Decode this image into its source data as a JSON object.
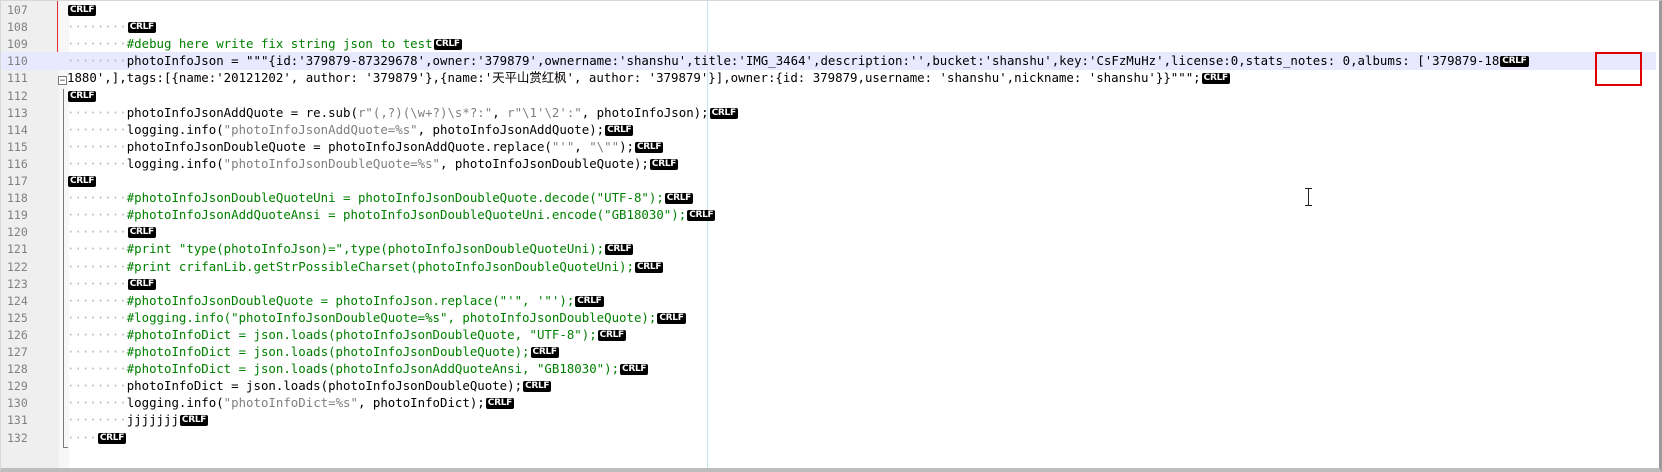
{
  "editor": {
    "eol_marker": "CRLF",
    "whitespace_marker": "·",
    "fold_box_symbol": "−",
    "colors": {
      "comment": "#008000",
      "string": "#808080",
      "current_line": "#e8e8ff",
      "highlight": "#e00000",
      "line_number": "#808080"
    },
    "lines": [
      {
        "number": "107",
        "indent": 0,
        "segments": [],
        "eol": true
      },
      {
        "number": "108",
        "indent": 8,
        "segments": [],
        "eol": true
      },
      {
        "number": "109",
        "indent": 8,
        "segments": [
          {
            "t": "#debug here write fix string json to test",
            "c": "cm"
          }
        ],
        "eol": true
      },
      {
        "number": "110",
        "indent": 8,
        "current": true,
        "segments": [
          {
            "t": "photoInfoJson = \"\"\"{id:'379879-87329678',owner:'379879',ownername:'shanshu',title:'IMG_3464',description:'',bucket:'shanshu',key:'CsFzMuHz',license:0,stats_notes: 0,albums: ['379879-18"
          }
        ],
        "eol": true
      },
      {
        "number": "111",
        "indent": 0,
        "segments": [
          {
            "t": "1880',],tags:[{name:'20121202', author: '379879'},{name:'天平山赏红枫', author: '379879'}],owner:{id: 379879,username: 'shanshu',nickname: 'shanshu'}}\"\"\";"
          }
        ],
        "eol": true
      },
      {
        "number": "112",
        "indent": 0,
        "segments": [],
        "eol": true
      },
      {
        "number": "113",
        "indent": 8,
        "segments": [
          {
            "t": "photoInfoJsonAddQuote = re.sub("
          },
          {
            "t": "r\"(,?)(\\w+?)\\s*?:\"",
            "c": "st"
          },
          {
            "t": ", "
          },
          {
            "t": "r\"\\1'\\2':\"",
            "c": "st"
          },
          {
            "t": ", photoInfoJson);"
          }
        ],
        "eol": true
      },
      {
        "number": "114",
        "indent": 8,
        "segments": [
          {
            "t": "logging.info("
          },
          {
            "t": "\"photoInfoJsonAddQuote=%s\"",
            "c": "st"
          },
          {
            "t": ", photoInfoJsonAddQuote);"
          }
        ],
        "eol": true
      },
      {
        "number": "115",
        "indent": 8,
        "segments": [
          {
            "t": "photoInfoJsonDoubleQuote = photoInfoJsonAddQuote.replace("
          },
          {
            "t": "\"'\"",
            "c": "st"
          },
          {
            "t": ", "
          },
          {
            "t": "\"\\\"\"",
            "c": "st"
          },
          {
            "t": ");"
          }
        ],
        "eol": true
      },
      {
        "number": "116",
        "indent": 8,
        "segments": [
          {
            "t": "logging.info("
          },
          {
            "t": "\"photoInfoJsonDoubleQuote=%s\"",
            "c": "st"
          },
          {
            "t": ", photoInfoJsonDoubleQuote);"
          }
        ],
        "eol": true
      },
      {
        "number": "117",
        "indent": 0,
        "segments": [],
        "eol": true
      },
      {
        "number": "118",
        "indent": 8,
        "segments": [
          {
            "t": "#photoInfoJsonDoubleQuoteUni = photoInfoJsonDoubleQuote.decode(\"UTF-8\");",
            "c": "cm"
          }
        ],
        "eol": true
      },
      {
        "number": "119",
        "indent": 8,
        "segments": [
          {
            "t": "#photoInfoJsonAddQuoteAnsi = photoInfoJsonDoubleQuoteUni.encode(\"GB18030\");",
            "c": "cm"
          }
        ],
        "eol": true
      },
      {
        "number": "120",
        "indent": 8,
        "segments": [],
        "eol": true
      },
      {
        "number": "121",
        "indent": 8,
        "segments": [
          {
            "t": "#print \"type(photoInfoJson)=\",type(photoInfoJsonDoubleQuoteUni);",
            "c": "cm"
          }
        ],
        "eol": true
      },
      {
        "number": "122",
        "indent": 8,
        "segments": [
          {
            "t": "#print crifanLib.getStrPossibleCharset(photoInfoJsonDoubleQuoteUni);",
            "c": "cm"
          }
        ],
        "eol": true
      },
      {
        "number": "123",
        "indent": 8,
        "segments": [],
        "eol": true
      },
      {
        "number": "124",
        "indent": 8,
        "segments": [
          {
            "t": "#photoInfoJsonDoubleQuote = photoInfoJson.replace(\"'\", '\"');",
            "c": "cm"
          }
        ],
        "eol": true
      },
      {
        "number": "125",
        "indent": 8,
        "segments": [
          {
            "t": "#logging.info(\"photoInfoJsonDoubleQuote=%s\", photoInfoJsonDoubleQuote);",
            "c": "cm"
          }
        ],
        "eol": true
      },
      {
        "number": "126",
        "indent": 8,
        "segments": [
          {
            "t": "#photoInfoDict = json.loads(photoInfoJsonDoubleQuote, \"UTF-8\");",
            "c": "cm"
          }
        ],
        "eol": true
      },
      {
        "number": "127",
        "indent": 8,
        "segments": [
          {
            "t": "#photoInfoDict = json.loads(photoInfoJsonDoubleQuote);",
            "c": "cm"
          }
        ],
        "eol": true
      },
      {
        "number": "128",
        "indent": 8,
        "segments": [
          {
            "t": "#photoInfoDict = json.loads(photoInfoJsonAddQuoteAnsi, \"GB18030\");",
            "c": "cm"
          }
        ],
        "eol": true
      },
      {
        "number": "129",
        "indent": 8,
        "segments": [
          {
            "t": "photoInfoDict = json.loads(photoInfoJsonDoubleQuote);"
          }
        ],
        "eol": true
      },
      {
        "number": "130",
        "indent": 8,
        "segments": [
          {
            "t": "logging.info("
          },
          {
            "t": "\"photoInfoDict=%s\"",
            "c": "st"
          },
          {
            "t": ", photoInfoDict);"
          }
        ],
        "eol": true
      },
      {
        "number": "131",
        "indent": 8,
        "segments": [
          {
            "t": "jjjjjjj"
          }
        ],
        "eol": true
      },
      {
        "number": "132",
        "indent": 4,
        "segments": [],
        "eol": true
      }
    ]
  }
}
